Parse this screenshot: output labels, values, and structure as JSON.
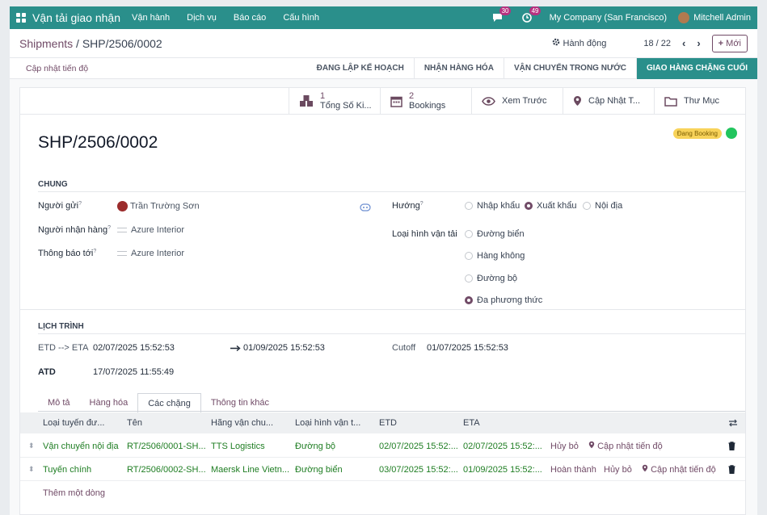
{
  "topbar": {
    "app_name": "Vận tải giao nhận",
    "menus": [
      "Vận hành",
      "Dịch vụ",
      "Báo cáo",
      "Cấu hình"
    ],
    "chat_count": "30",
    "activity_count": "49",
    "company": "My Company (San Francisco)",
    "user": "Mitchell Admin"
  },
  "breadcrumb": {
    "parent": "Shipments",
    "current": "SHP/2506/0002"
  },
  "control": {
    "action_label": "Hành động",
    "pager": "18 / 22",
    "new_label": "Mới"
  },
  "status": {
    "update_link": "Cập nhật tiến độ",
    "stages": [
      "ĐANG LẬP KẾ HOẠCH",
      "NHẬN HÀNG HÓA",
      "VẬN CHUYỂN TRONG NƯỚC",
      "GIAO HÀNG CHẶNG CUỐI"
    ]
  },
  "smart_buttons": [
    {
      "count": "1",
      "label": "Tổng Số Ki..."
    },
    {
      "count": "2",
      "label": "Bookings"
    },
    {
      "count": "",
      "label": "Xem Trước"
    },
    {
      "count": "",
      "label": "Cập Nhật T..."
    },
    {
      "count": "",
      "label": "Thư Mục"
    }
  ],
  "record": {
    "name": "SHP/2506/0002",
    "tag": "Đang Booking"
  },
  "general": {
    "title": "CHUNG",
    "sender_label": "Người gửi",
    "sender": "Trần Trường Sơn",
    "consignee_label": "Người nhận hàng",
    "consignee": "Azure Interior",
    "notify_label": "Thông báo tới",
    "notify": "Azure Interior",
    "direction_label": "Hướng",
    "directions": [
      "Nhập khẩu",
      "Xuất khẩu",
      "Nội địa"
    ],
    "transport_label": "Loại hình vận tải",
    "transports": [
      "Đường biển",
      "Hàng không",
      "Đường bộ",
      "Đa phương thức"
    ]
  },
  "schedule": {
    "title": "LỊCH TRÌNH",
    "etd_eta_label": "ETD --> ETA",
    "etd": "02/07/2025 15:52:53",
    "eta": "01/09/2025 15:52:53",
    "cutoff_label": "Cutoff",
    "cutoff": "01/07/2025 15:52:53",
    "atd_label": "ATD",
    "atd": "17/07/2025 11:55:49"
  },
  "tabs": [
    "Mô tả",
    "Hàng hóa",
    "Các chặng",
    "Thông tin khác"
  ],
  "table": {
    "headers": [
      "Loại tuyến đư...",
      "Tên",
      "Hãng vận chu...",
      "Loại hình vận t...",
      "ETD",
      "ETA"
    ],
    "rows": [
      {
        "type": "Vận chuyển nội địa",
        "name": "RT/2506/0001-SH...",
        "carrier": "TTS Logistics",
        "mode": "Đường bộ",
        "etd": "02/07/2025 15:52:...",
        "eta": "02/07/2025 15:52:...",
        "done": "",
        "cancel": "Hủy bỏ",
        "update": "Cập nhật tiến độ"
      },
      {
        "type": "Tuyến chính",
        "name": "RT/2506/0002-SH...",
        "carrier": "Maersk Line Vietn...",
        "mode": "Đường biển",
        "etd": "03/07/2025 15:52:...",
        "eta": "01/09/2025 15:52:...",
        "done": "Hoàn thành",
        "cancel": "Hủy bỏ",
        "update": "Cập nhật tiến độ"
      }
    ],
    "add_line": "Thêm một dòng"
  }
}
